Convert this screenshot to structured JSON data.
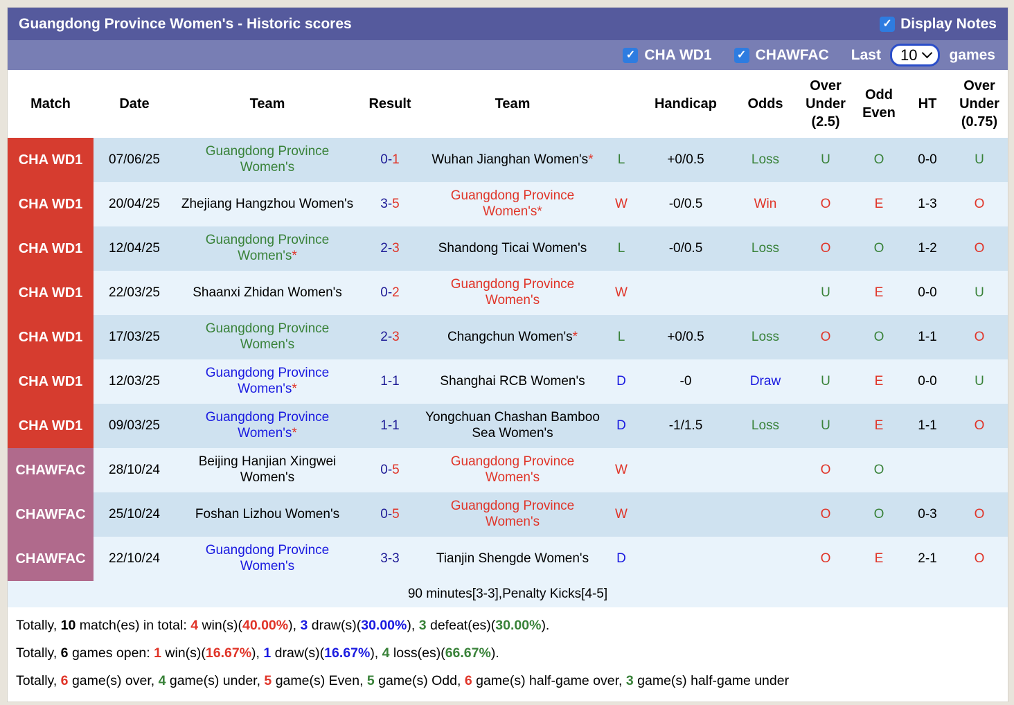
{
  "title": "Guangdong Province Women's - Historic scores",
  "display_notes_label": "Display Notes",
  "filters": {
    "league1_label": "CHA WD1",
    "league2_label": "CHAWFAC",
    "last_label": "Last",
    "games_label": "games",
    "last_value": "10"
  },
  "colors": {
    "accent_titlebar": "#555a9d",
    "accent_filterbar": "#787eb4",
    "checkbox_blue": "#2e7ce0",
    "cha_wd1_red": "#d63c2f",
    "chawfac_mauve": "#b06a8c",
    "row_dark": "#cfe2f0",
    "row_light": "#e9f3fb",
    "win_red": "#e03428",
    "loss_green": "#398239",
    "draw_blue": "#1a1ae0",
    "score_navy": "#1e1b96"
  },
  "table": {
    "columns": [
      "Match",
      "Date",
      "Team",
      "Result",
      "Team",
      "",
      "Handicap",
      "Odds",
      "Over Under (2.5)",
      "Odd Even",
      "HT",
      "Over Under (0.75)"
    ],
    "rows": [
      {
        "match": "CHA WD1",
        "league": "CHAWD1",
        "date": "07/06/25",
        "home": {
          "t": "Guangdong Province Women's",
          "c": "green",
          "star": false
        },
        "result": [
          {
            "t": "0",
            "c": "navy"
          },
          {
            "t": "-",
            "c": "navy"
          },
          {
            "t": "1",
            "c": "red"
          }
        ],
        "away": {
          "t": "Wuhan Jianghan Women's",
          "c": "black",
          "star": true
        },
        "wld": {
          "t": "L",
          "c": "green"
        },
        "handicap": "+0/0.5",
        "odds": {
          "t": "Loss",
          "c": "green"
        },
        "ou25": {
          "t": "U",
          "c": "green"
        },
        "oe": {
          "t": "O",
          "c": "green"
        },
        "ht": "0-0",
        "ou075": {
          "t": "U",
          "c": "green"
        }
      },
      {
        "match": "CHA WD1",
        "league": "CHAWD1",
        "date": "20/04/25",
        "home": {
          "t": "Zhejiang Hangzhou Women's",
          "c": "black",
          "star": false
        },
        "result": [
          {
            "t": "3",
            "c": "navy"
          },
          {
            "t": "-",
            "c": "navy"
          },
          {
            "t": "5",
            "c": "red"
          }
        ],
        "away": {
          "t": "Guangdong Province Women's",
          "c": "red",
          "star": true
        },
        "wld": {
          "t": "W",
          "c": "red"
        },
        "handicap": "-0/0.5",
        "odds": {
          "t": "Win",
          "c": "red"
        },
        "ou25": {
          "t": "O",
          "c": "red"
        },
        "oe": {
          "t": "E",
          "c": "red"
        },
        "ht": "1-3",
        "ou075": {
          "t": "O",
          "c": "red"
        }
      },
      {
        "match": "CHA WD1",
        "league": "CHAWD1",
        "date": "12/04/25",
        "home": {
          "t": "Guangdong Province Women's",
          "c": "green",
          "star": true
        },
        "result": [
          {
            "t": "2",
            "c": "navy"
          },
          {
            "t": "-",
            "c": "navy"
          },
          {
            "t": "3",
            "c": "red"
          }
        ],
        "away": {
          "t": "Shandong Ticai Women's",
          "c": "black",
          "star": false
        },
        "wld": {
          "t": "L",
          "c": "green"
        },
        "handicap": "-0/0.5",
        "odds": {
          "t": "Loss",
          "c": "green"
        },
        "ou25": {
          "t": "O",
          "c": "red"
        },
        "oe": {
          "t": "O",
          "c": "green"
        },
        "ht": "1-2",
        "ou075": {
          "t": "O",
          "c": "red"
        }
      },
      {
        "match": "CHA WD1",
        "league": "CHAWD1",
        "date": "22/03/25",
        "home": {
          "t": "Shaanxi Zhidan Women's",
          "c": "black",
          "star": false
        },
        "result": [
          {
            "t": "0",
            "c": "navy"
          },
          {
            "t": "-",
            "c": "navy"
          },
          {
            "t": "2",
            "c": "red"
          }
        ],
        "away": {
          "t": "Guangdong Province Women's",
          "c": "red",
          "star": false
        },
        "wld": {
          "t": "W",
          "c": "red"
        },
        "handicap": "",
        "odds": {
          "t": "",
          "c": "black"
        },
        "ou25": {
          "t": "U",
          "c": "green"
        },
        "oe": {
          "t": "E",
          "c": "red"
        },
        "ht": "0-0",
        "ou075": {
          "t": "U",
          "c": "green"
        }
      },
      {
        "match": "CHA WD1",
        "league": "CHAWD1",
        "date": "17/03/25",
        "home": {
          "t": "Guangdong Province Women's",
          "c": "green",
          "star": false
        },
        "result": [
          {
            "t": "2",
            "c": "navy"
          },
          {
            "t": "-",
            "c": "navy"
          },
          {
            "t": "3",
            "c": "red"
          }
        ],
        "away": {
          "t": "Changchun Women's",
          "c": "black",
          "star": true
        },
        "wld": {
          "t": "L",
          "c": "green"
        },
        "handicap": "+0/0.5",
        "odds": {
          "t": "Loss",
          "c": "green"
        },
        "ou25": {
          "t": "O",
          "c": "red"
        },
        "oe": {
          "t": "O",
          "c": "green"
        },
        "ht": "1-1",
        "ou075": {
          "t": "O",
          "c": "red"
        }
      },
      {
        "match": "CHA WD1",
        "league": "CHAWD1",
        "date": "12/03/25",
        "home": {
          "t": "Guangdong Province Women's",
          "c": "blue",
          "star": true
        },
        "result": [
          {
            "t": "1",
            "c": "navy"
          },
          {
            "t": "-",
            "c": "navy"
          },
          {
            "t": "1",
            "c": "navy"
          }
        ],
        "away": {
          "t": "Shanghai RCB Women's",
          "c": "black",
          "star": false
        },
        "wld": {
          "t": "D",
          "c": "blue"
        },
        "handicap": "-0",
        "odds": {
          "t": "Draw",
          "c": "blue"
        },
        "ou25": {
          "t": "U",
          "c": "green"
        },
        "oe": {
          "t": "E",
          "c": "red"
        },
        "ht": "0-0",
        "ou075": {
          "t": "U",
          "c": "green"
        }
      },
      {
        "match": "CHA WD1",
        "league": "CHAWD1",
        "date": "09/03/25",
        "home": {
          "t": "Guangdong Province Women's",
          "c": "blue",
          "star": true
        },
        "result": [
          {
            "t": "1",
            "c": "navy"
          },
          {
            "t": "-",
            "c": "navy"
          },
          {
            "t": "1",
            "c": "navy"
          }
        ],
        "away": {
          "t": "Yongchuan Chashan Bamboo Sea Women's",
          "c": "black",
          "star": false
        },
        "wld": {
          "t": "D",
          "c": "blue"
        },
        "handicap": "-1/1.5",
        "odds": {
          "t": "Loss",
          "c": "green"
        },
        "ou25": {
          "t": "U",
          "c": "green"
        },
        "oe": {
          "t": "E",
          "c": "red"
        },
        "ht": "1-1",
        "ou075": {
          "t": "O",
          "c": "red"
        }
      },
      {
        "match": "CHAWFAC",
        "league": "CHAWFAC",
        "date": "28/10/24",
        "home": {
          "t": "Beijing Hanjian Xingwei Women's",
          "c": "black",
          "star": false
        },
        "result": [
          {
            "t": "0",
            "c": "navy"
          },
          {
            "t": "-",
            "c": "navy"
          },
          {
            "t": "5",
            "c": "red"
          }
        ],
        "away": {
          "t": "Guangdong Province Women's",
          "c": "red",
          "star": false
        },
        "wld": {
          "t": "W",
          "c": "red"
        },
        "handicap": "",
        "odds": {
          "t": "",
          "c": "black"
        },
        "ou25": {
          "t": "O",
          "c": "red"
        },
        "oe": {
          "t": "O",
          "c": "green"
        },
        "ht": "",
        "ou075": {
          "t": "",
          "c": "black"
        }
      },
      {
        "match": "CHAWFAC",
        "league": "CHAWFAC",
        "date": "25/10/24",
        "home": {
          "t": "Foshan Lizhou Women's",
          "c": "black",
          "star": false
        },
        "result": [
          {
            "t": "0",
            "c": "navy"
          },
          {
            "t": "-",
            "c": "navy"
          },
          {
            "t": "5",
            "c": "red"
          }
        ],
        "away": {
          "t": "Guangdong Province Women's",
          "c": "red",
          "star": false
        },
        "wld": {
          "t": "W",
          "c": "red"
        },
        "handicap": "",
        "odds": {
          "t": "",
          "c": "black"
        },
        "ou25": {
          "t": "O",
          "c": "red"
        },
        "oe": {
          "t": "O",
          "c": "green"
        },
        "ht": "0-3",
        "ou075": {
          "t": "O",
          "c": "red"
        }
      },
      {
        "match": "CHAWFAC",
        "league": "CHAWFAC",
        "date": "22/10/24",
        "home": {
          "t": "Guangdong Province Women's",
          "c": "blue",
          "star": false
        },
        "result": [
          {
            "t": "3",
            "c": "navy"
          },
          {
            "t": "-",
            "c": "navy"
          },
          {
            "t": "3",
            "c": "navy"
          }
        ],
        "away": {
          "t": "Tianjin Shengde Women's",
          "c": "black",
          "star": false
        },
        "wld": {
          "t": "D",
          "c": "blue"
        },
        "handicap": "",
        "odds": {
          "t": "",
          "c": "black"
        },
        "ou25": {
          "t": "O",
          "c": "red"
        },
        "oe": {
          "t": "E",
          "c": "red"
        },
        "ht": "2-1",
        "ou075": {
          "t": "O",
          "c": "red"
        }
      }
    ],
    "note": "90 minutes[3-3],Penalty Kicks[4-5]"
  },
  "totals": [
    [
      {
        "t": "Totally, ",
        "c": "k"
      },
      {
        "t": "10",
        "c": "kb"
      },
      {
        "t": " match(es) in total: ",
        "c": "k"
      },
      {
        "t": "4",
        "c": "rb"
      },
      {
        "t": " win(s)(",
        "c": "k"
      },
      {
        "t": "40.00%",
        "c": "rb"
      },
      {
        "t": "), ",
        "c": "k"
      },
      {
        "t": "3",
        "c": "bb"
      },
      {
        "t": " draw(s)(",
        "c": "k"
      },
      {
        "t": "30.00%",
        "c": "bb"
      },
      {
        "t": "), ",
        "c": "k"
      },
      {
        "t": "3",
        "c": "gb"
      },
      {
        "t": " defeat(es)(",
        "c": "k"
      },
      {
        "t": "30.00%",
        "c": "gb"
      },
      {
        "t": ").",
        "c": "k"
      }
    ],
    [
      {
        "t": "Totally, ",
        "c": "k"
      },
      {
        "t": "6",
        "c": "kb"
      },
      {
        "t": " games open: ",
        "c": "k"
      },
      {
        "t": "1",
        "c": "rb"
      },
      {
        "t": " win(s)(",
        "c": "k"
      },
      {
        "t": "16.67%",
        "c": "rb"
      },
      {
        "t": "), ",
        "c": "k"
      },
      {
        "t": "1",
        "c": "bb"
      },
      {
        "t": " draw(s)(",
        "c": "k"
      },
      {
        "t": "16.67%",
        "c": "bb"
      },
      {
        "t": "), ",
        "c": "k"
      },
      {
        "t": "4",
        "c": "gb"
      },
      {
        "t": " loss(es)(",
        "c": "k"
      },
      {
        "t": "66.67%",
        "c": "gb"
      },
      {
        "t": ").",
        "c": "k"
      }
    ],
    [
      {
        "t": "Totally, ",
        "c": "k"
      },
      {
        "t": "6",
        "c": "rb"
      },
      {
        "t": " game(s) over, ",
        "c": "k"
      },
      {
        "t": "4",
        "c": "gb"
      },
      {
        "t": " game(s) under, ",
        "c": "k"
      },
      {
        "t": "5",
        "c": "rb"
      },
      {
        "t": " game(s) Even, ",
        "c": "k"
      },
      {
        "t": "5",
        "c": "gb"
      },
      {
        "t": " game(s) Odd, ",
        "c": "k"
      },
      {
        "t": "6",
        "c": "rb"
      },
      {
        "t": " game(s) half-game over, ",
        "c": "k"
      },
      {
        "t": "3",
        "c": "gb"
      },
      {
        "t": " game(s) half-game under",
        "c": "k"
      }
    ]
  ]
}
